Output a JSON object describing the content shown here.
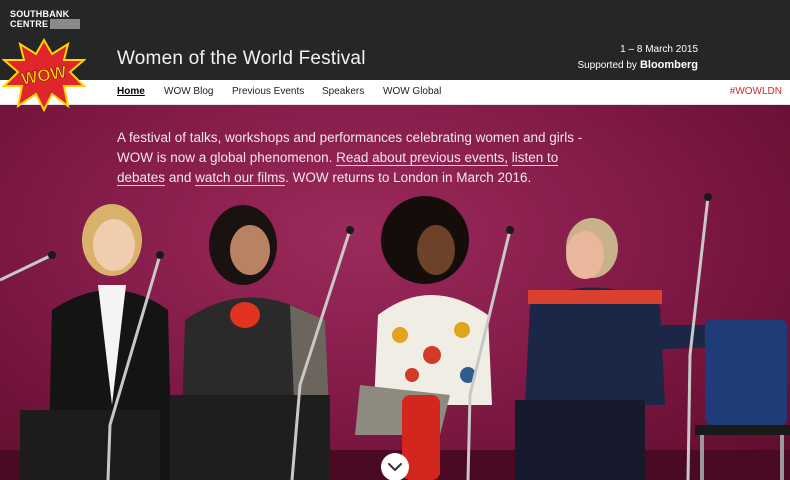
{
  "brand": {
    "org_line1": "SOUTHBANK",
    "org_line2": "CENTRE",
    "badge_text": "WOW",
    "festival_title": "Women of the World Festival",
    "dates": "1 – 8 March 2015",
    "supported_by": "Supported by",
    "sponsor": "Bloomberg"
  },
  "nav": {
    "items": [
      {
        "label": "Home",
        "active": true
      },
      {
        "label": "WOW Blog",
        "active": false
      },
      {
        "label": "Previous Events",
        "active": false
      },
      {
        "label": "Speakers",
        "active": false
      },
      {
        "label": "WOW Global",
        "active": false
      }
    ],
    "hashtag": "#WOWLDN"
  },
  "hero": {
    "intro": "A festival of talks, workshops and performances celebrating women and girls - WOW is now a global phenomenon.",
    "link1": "Read about previous events,",
    "link2": "listen to debates",
    "middle": "and",
    "link3": "watch our films",
    "outro": ". WOW returns to London in March 2016."
  },
  "icons": {
    "scroll": "chevron-down-icon"
  },
  "colors": {
    "header_bg": "#262626",
    "hero_bg": "#861d4b",
    "accent_red": "#d4282d",
    "badge_yellow": "#ffd400"
  }
}
